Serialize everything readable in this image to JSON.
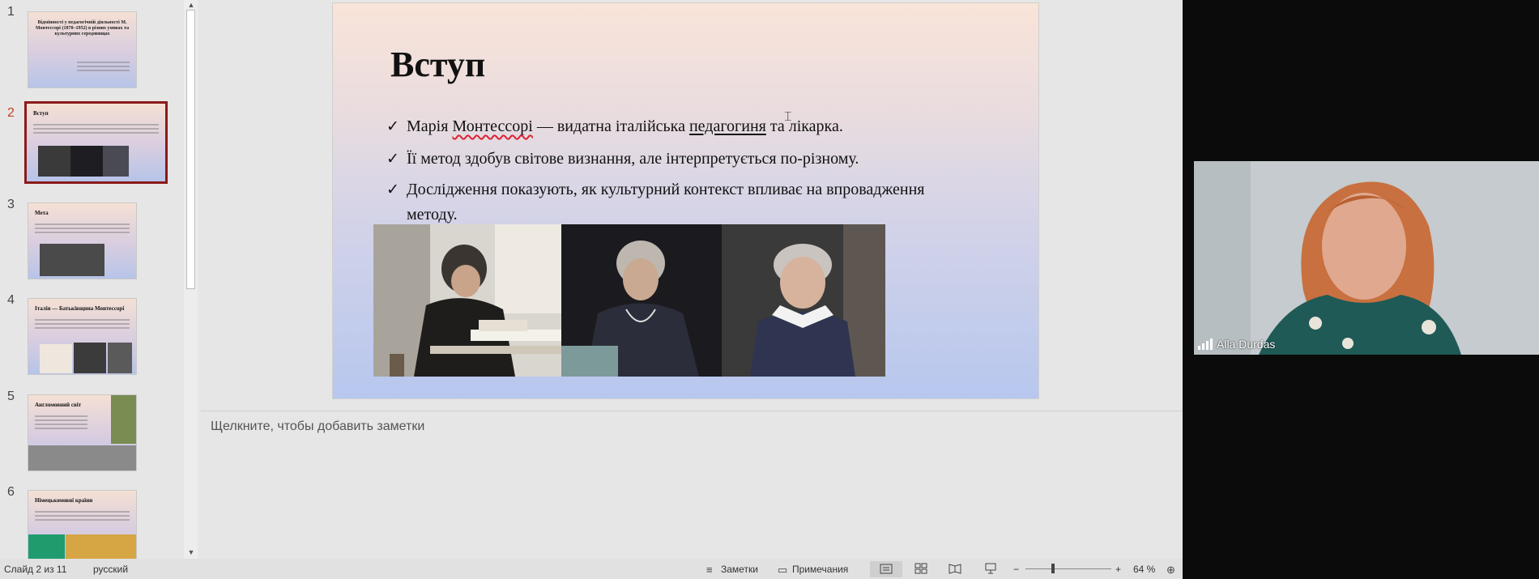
{
  "thumbnails": [
    {
      "num": "1",
      "title": "Відмінності у педагогічній діяльності М. Монтессорі (1870–1952) в різних умовах та культурних середовищах",
      "selected": false
    },
    {
      "num": "2",
      "title": "Вступ",
      "selected": true
    },
    {
      "num": "3",
      "title": "Мета",
      "selected": false
    },
    {
      "num": "4",
      "title": "Італія — Батьківщина Монтессорі",
      "selected": false
    },
    {
      "num": "5",
      "title": "Англомовний світ",
      "selected": false
    },
    {
      "num": "6",
      "title": "Німецькомовні країни",
      "selected": false
    }
  ],
  "slide": {
    "title": "Вступ",
    "bullets": [
      {
        "pre": "Марія ",
        "wavy": "Монтессорі",
        "mid": " — видатна італійська ",
        "ul": "педагогиня",
        "post": " та лікарка."
      },
      {
        "text": "Її метод здобув світове визнання, але інтерпретується по-різному."
      },
      {
        "text": "Дослідження показують, як культурний контекст впливає на впровадження"
      },
      {
        "text": "методу."
      }
    ],
    "check": "✓"
  },
  "notes_placeholder": "Щелкните, чтобы добавить заметки",
  "status": {
    "slide_info": "Слайд 2 из 11",
    "language": "русский",
    "notes_label": "Заметки",
    "comments_label": "Примечания",
    "zoom": "64 %",
    "zoom_fraction": 0.64
  },
  "video": {
    "name": "Alla Durdas"
  },
  "colors": {
    "selected_border": "#8b1a1a",
    "selected_num": "#c43e1c",
    "accent": "#c43e1c"
  },
  "icons": {
    "check": "checkmark-icon",
    "fit": "fit-to-window-icon"
  }
}
